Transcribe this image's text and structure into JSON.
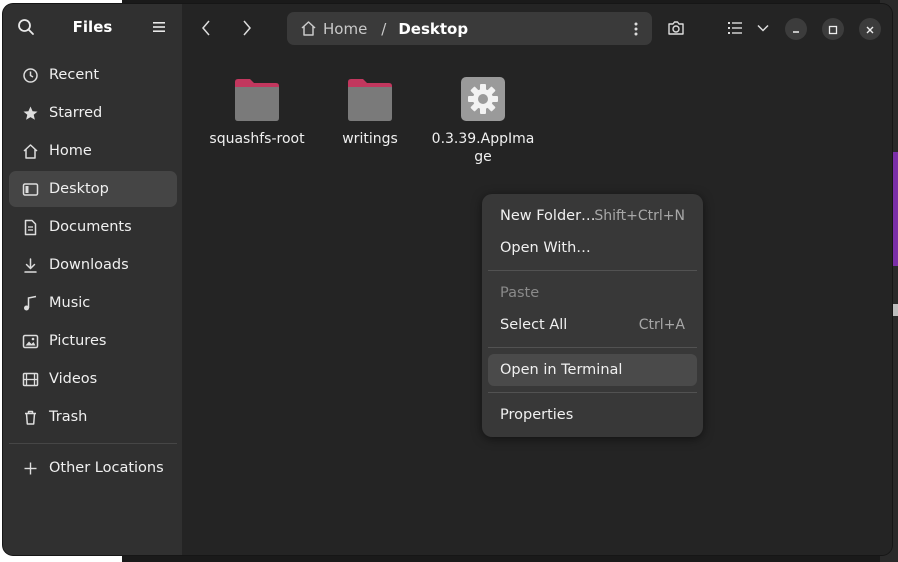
{
  "sidebar": {
    "title": "Files",
    "items": [
      {
        "label": "Recent",
        "icon": "clock-icon"
      },
      {
        "label": "Starred",
        "icon": "star-icon"
      },
      {
        "label": "Home",
        "icon": "home-icon"
      },
      {
        "label": "Desktop",
        "icon": "desktop-icon",
        "active": true
      },
      {
        "label": "Documents",
        "icon": "document-icon"
      },
      {
        "label": "Downloads",
        "icon": "download-icon"
      },
      {
        "label": "Music",
        "icon": "music-icon"
      },
      {
        "label": "Pictures",
        "icon": "picture-icon"
      },
      {
        "label": "Videos",
        "icon": "video-icon"
      },
      {
        "label": "Trash",
        "icon": "trash-icon"
      }
    ],
    "other_locations": "Other Locations"
  },
  "pathbar": {
    "home_label": "Home",
    "separator": "/",
    "current": "Desktop"
  },
  "files": [
    {
      "name": "squashfs-root",
      "type": "folder"
    },
    {
      "name": "writings",
      "type": "folder"
    },
    {
      "name": "0.3.39.AppImage",
      "type": "executable"
    }
  ],
  "context_menu": {
    "new_folder": {
      "label": "New Folder…",
      "accel": "Shift+Ctrl+N"
    },
    "open_with": {
      "label": "Open With…"
    },
    "paste": {
      "label": "Paste"
    },
    "select_all": {
      "label": "Select All",
      "accel": "Ctrl+A"
    },
    "open_terminal": {
      "label": "Open in Terminal"
    },
    "properties": {
      "label": "Properties"
    }
  },
  "colors": {
    "window_bg": "#242424",
    "sidebar_bg": "#303030",
    "menu_bg": "#383838",
    "folder_tab": "#c2375e",
    "folder_body": "#7a7a7a"
  }
}
